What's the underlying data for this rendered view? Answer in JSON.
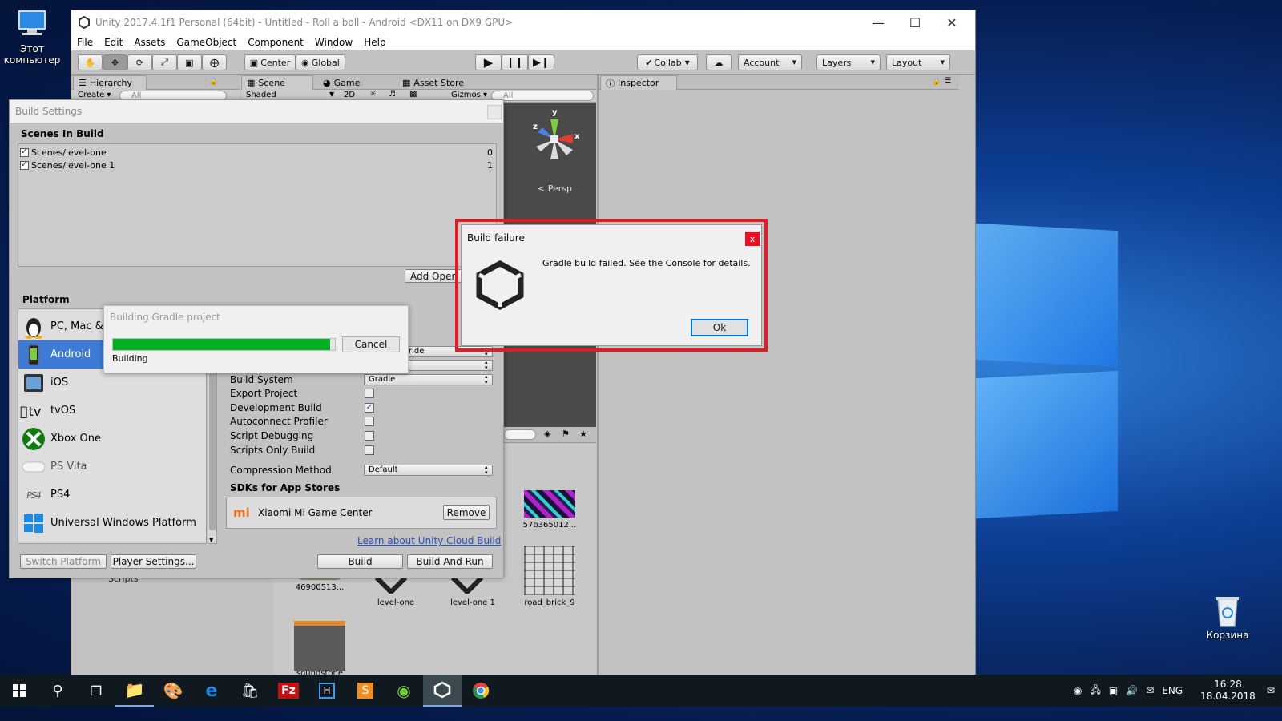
{
  "desktop": {
    "icons": [
      {
        "label": "Этот компьютер",
        "icon": "computer-icon"
      },
      {
        "label": "Корзина",
        "icon": "recycle-bin-icon"
      }
    ]
  },
  "window": {
    "title": "Unity 2017.4.1f1 Personal (64bit) - Untitled - Roll a boll - Android <DX11 on DX9 GPU>",
    "controls": [
      "minimize",
      "maximize",
      "close"
    ]
  },
  "menu": [
    "File",
    "Edit",
    "Assets",
    "GameObject",
    "Component",
    "Window",
    "Help"
  ],
  "toolbar": {
    "center": "Center",
    "global": "Global",
    "collab": "Collab",
    "account": "Account",
    "layers": "Layers",
    "layout": "Layout"
  },
  "panels": {
    "hierarchy_tab": "Hierarchy",
    "hierarchy_create": "Create",
    "search_all": "All",
    "scene_tab": "Scene",
    "game_tab": "Game",
    "asset_store_tab": "Asset Store",
    "shaded": "Shaded",
    "mode_2d": "2D",
    "gizmos": "Gizmos",
    "inspector_tab": "Inspector",
    "persp": "Persp",
    "gizmo_axes": [
      "y",
      "z",
      "x"
    ]
  },
  "assets": [
    {
      "label": "57b365012...",
      "kind": "texture-neon"
    },
    {
      "label": "46900513...",
      "kind": "texture"
    },
    {
      "label": "level-one",
      "kind": "unity-scene"
    },
    {
      "label": "level-one 1",
      "kind": "unity-scene"
    },
    {
      "label": "road_brick_9",
      "kind": "texture-brick"
    },
    {
      "label": "soundstone",
      "kind": "texture-dark"
    }
  ],
  "scripts_label": "Scripts",
  "build_settings": {
    "title": "Build Settings",
    "scenes_header": "Scenes In Build",
    "scenes": [
      {
        "name": "Scenes/level-one",
        "index": "0",
        "checked": "✓"
      },
      {
        "name": "Scenes/level-one 1",
        "index": "1",
        "checked": "✓"
      }
    ],
    "add_open": "Add Open",
    "platform_header": "Platform",
    "platforms": [
      {
        "label": "PC, Mac & Linux Standalone",
        "icon": "linux-tux-icon"
      },
      {
        "label": "Android",
        "icon": "android-phone-icon"
      },
      {
        "label": "iOS",
        "icon": "ios-device-icon"
      },
      {
        "label": "tvOS",
        "icon": "apple-tv-icon"
      },
      {
        "label": "Xbox One",
        "icon": "xbox-icon"
      },
      {
        "label": "PS Vita",
        "icon": "ps-vita-icon"
      },
      {
        "label": "PS4",
        "icon": "ps4-icon"
      },
      {
        "label": "Universal Windows Platform",
        "icon": "windows-icon"
      }
    ],
    "texture_override_partial": "ride",
    "options": {
      "build_system_label": "Build System",
      "build_system_value": "Gradle",
      "export_project": "Export Project",
      "development_build": "Development Build",
      "development_checked": "✓",
      "autoconnect_profiler": "Autoconnect Profiler",
      "script_debugging": "Script Debugging",
      "scripts_only_build": "Scripts Only Build",
      "compression_label": "Compression Method",
      "compression_value": "Default"
    },
    "sdks_header": "SDKs for App Stores",
    "sdk_name": "Xiaomi Mi Game Center",
    "sdk_remove": "Remove",
    "cloud_link": "Learn about Unity Cloud Build",
    "switch_platform": "Switch Platform",
    "player_settings": "Player Settings...",
    "build": "Build",
    "build_and_run": "Build And Run"
  },
  "gradle_dialog": {
    "title": "Building Gradle project",
    "status": "Building",
    "cancel": "Cancel",
    "progress": 0.98,
    "progress_color": "#06b025"
  },
  "failure_dialog": {
    "title": "Build failure",
    "message": "Gradle build failed.  See the Console for details.",
    "ok": "Ok",
    "close": "x",
    "highlight_color": "#e21b24"
  },
  "taskbar": {
    "language": "ENG",
    "time": "16:28",
    "date": "18.04.2018"
  }
}
